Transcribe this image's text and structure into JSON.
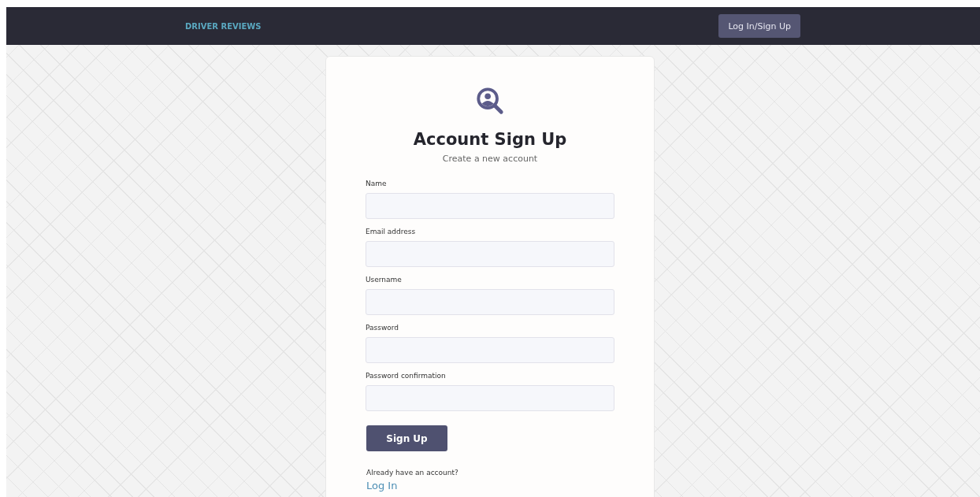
{
  "navbar": {
    "brand": "DRIVER REVIEWS",
    "login_button": "Log In/Sign Up"
  },
  "form": {
    "title": "Account Sign Up",
    "subtitle": "Create a new account",
    "fields": [
      {
        "label": "Name"
      },
      {
        "label": "Email address"
      },
      {
        "label": "Username"
      },
      {
        "label": "Password"
      },
      {
        "label": "Password confirmation"
      }
    ],
    "submit": "Sign Up",
    "footer_text": "Already have an account?",
    "footer_link": "Log In"
  }
}
